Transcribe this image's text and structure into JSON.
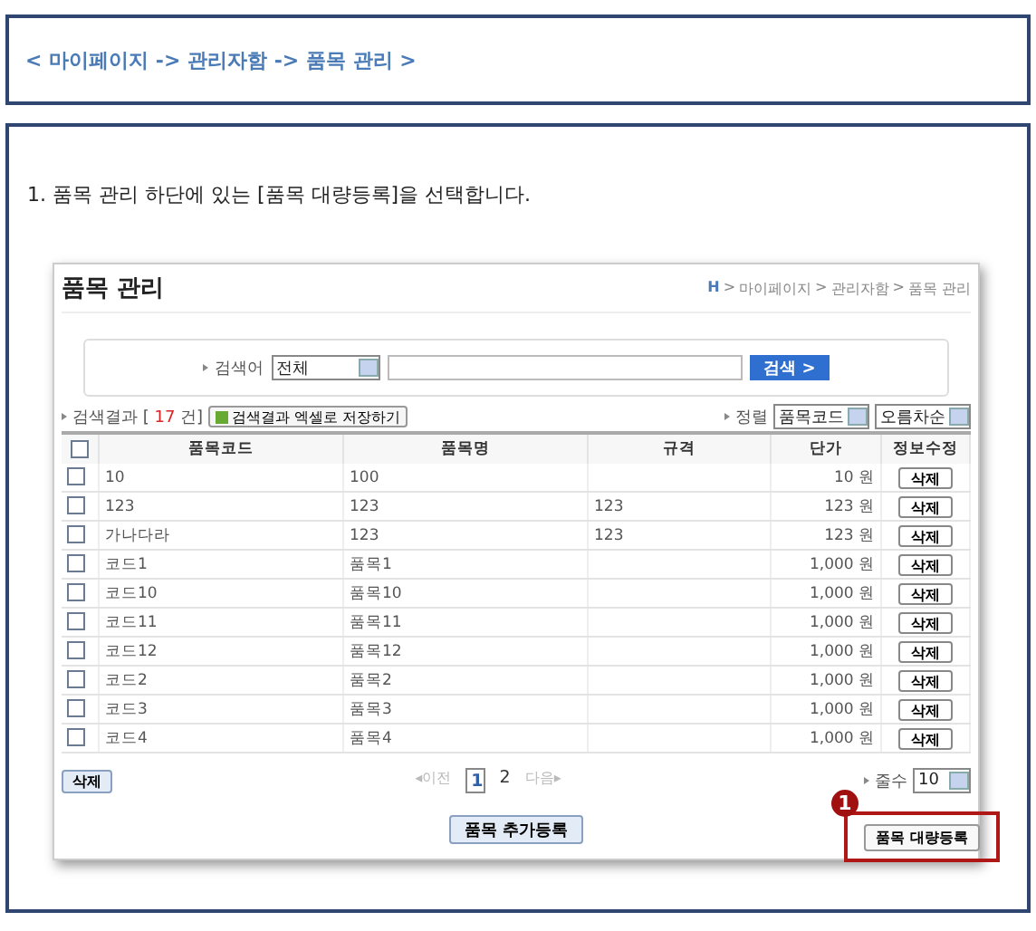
{
  "breadcrumb": "< 마이페이지  -> 관리자함 -> 품목 관리 >",
  "instruction": "1. 품목 관리 하단에 있는 [품목 대량등록]을 선택합니다.",
  "screen": {
    "title": "품목 관리",
    "path": [
      {
        "label": "H",
        "kind": "home"
      },
      {
        "label": ">",
        "kind": "sep"
      },
      {
        "label": "마이페이지",
        "kind": "text"
      },
      {
        "label": ">",
        "kind": "sep"
      },
      {
        "label": "관리자함",
        "kind": "text"
      },
      {
        "label": ">",
        "kind": "sep"
      },
      {
        "label": "품목 관리",
        "kind": "text"
      }
    ],
    "search": {
      "label": "검색어",
      "scope": "전체",
      "button": "검색 >"
    },
    "result": {
      "label": "검색결과 [",
      "count": "17",
      "suffix": "건]",
      "excel_button": "검색결과 엑셀로 저장하기"
    },
    "sort": {
      "label": "정렬",
      "field": "품목코드",
      "order": "오름차순"
    },
    "select_all": {
      "checked": false
    },
    "columns": [
      "품목코드",
      "품목명",
      "규격",
      "단가",
      "정보수정"
    ],
    "rows": [
      {
        "checked": false,
        "code": "10",
        "name": "100",
        "spec": "",
        "price": "10 원",
        "action": "삭제"
      },
      {
        "checked": false,
        "code": "123",
        "name": "123",
        "spec": "123",
        "price": "123 원",
        "action": "삭제"
      },
      {
        "checked": false,
        "code": "가나다라",
        "name": "123",
        "spec": "123",
        "price": "123 원",
        "action": "삭제"
      },
      {
        "checked": false,
        "code": "코드1",
        "name": "품목1",
        "spec": "",
        "price": "1,000 원",
        "action": "삭제"
      },
      {
        "checked": false,
        "code": "코드10",
        "name": "품목10",
        "spec": "",
        "price": "1,000 원",
        "action": "삭제"
      },
      {
        "checked": false,
        "code": "코드11",
        "name": "품목11",
        "spec": "",
        "price": "1,000 원",
        "action": "삭제"
      },
      {
        "checked": false,
        "code": "코드12",
        "name": "품목12",
        "spec": "",
        "price": "1,000 원",
        "action": "삭제"
      },
      {
        "checked": false,
        "code": "코드2",
        "name": "품목2",
        "spec": "",
        "price": "1,000 원",
        "action": "삭제"
      },
      {
        "checked": false,
        "code": "코드3",
        "name": "품목3",
        "spec": "",
        "price": "1,000 원",
        "action": "삭제"
      },
      {
        "checked": false,
        "code": "코드4",
        "name": "품목4",
        "spec": "",
        "price": "1,000 원",
        "action": "삭제"
      }
    ],
    "delete_button": "삭제",
    "pages": [
      {
        "label": "◂이전",
        "kind": "nav",
        "disabled": true,
        "selected": false
      },
      {
        "label": "1",
        "kind": "page",
        "disabled": false,
        "selected": true
      },
      {
        "label": "2",
        "kind": "page",
        "disabled": false,
        "selected": false
      },
      {
        "label": "다음▸",
        "kind": "nav",
        "disabled": true,
        "selected": false
      }
    ],
    "page_size": {
      "label": "줄수",
      "value": "10"
    },
    "add_button": "품목 추가등록",
    "bulk_button": "품목 대량등록"
  },
  "callout": {
    "number": "1"
  }
}
